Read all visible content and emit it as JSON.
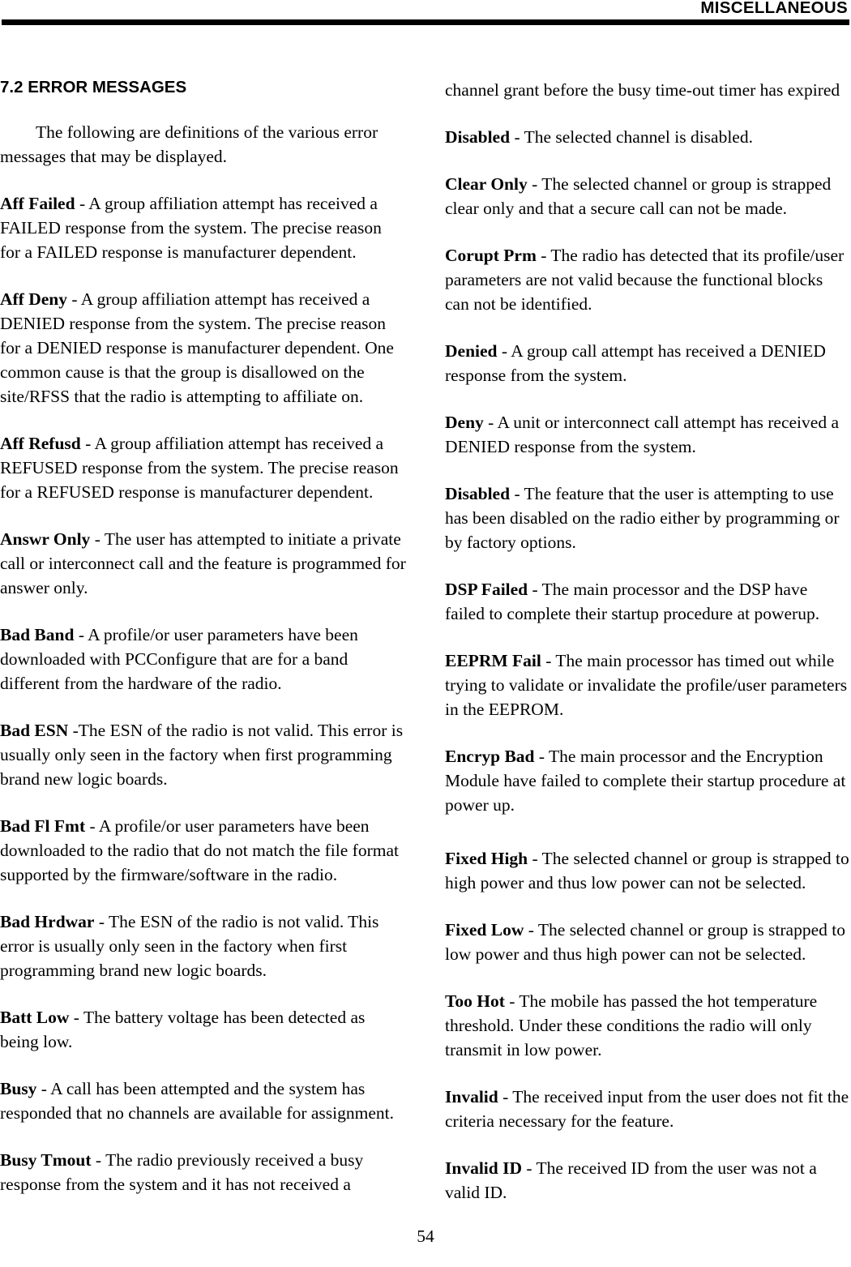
{
  "header": {
    "title": "MISCELLANEOUS"
  },
  "footer": {
    "page_number": "54"
  },
  "left_column": {
    "section_heading": "7.2 ERROR MESSAGES",
    "intro": "The following are definitions of the various error messages that may be displayed.",
    "entries": [
      {
        "term": "Aff Failed",
        "separator": " - ",
        "definition": "A group affiliation attempt has received a FAILED response from the system. The precise reason for a FAILED response is manufacturer dependent."
      },
      {
        "term": "Aff Deny",
        "separator": " - ",
        "definition": "A group affiliation attempt has received a DENIED response from the system. The precise reason for a DENIED response is manufacturer dependent. One common cause is that the group is disallowed on the site/RFSS that the radio is attempting to affiliate on."
      },
      {
        "term": "Aff Refusd",
        "separator": " - ",
        "definition": "A group affiliation attempt has received a REFUSED response from the system. The precise reason for a REFUSED response is manufacturer dependent."
      },
      {
        "term": "Answr Only",
        "separator": " - ",
        "definition": "The user has attempted to initiate a private call or interconnect call and the feature is programmed for answer only."
      },
      {
        "term": "Bad Band",
        "separator": " - ",
        "definition": "A profile/or user parameters have been downloaded with PCConfigure that are for a band different from the hardware of the radio."
      },
      {
        "term": "Bad ESN",
        "separator": " -",
        "definition": "The ESN of the radio is not valid. This error is usually only seen in the factory when first programming brand new logic boards."
      },
      {
        "term": "Bad Fl Fmt",
        "separator": " - ",
        "definition": "A profile/or user parameters have been downloaded to the radio that do not match the file format supported by the firmware/software in the radio."
      },
      {
        "term": "Bad Hrdwar",
        "separator": " - ",
        "definition": "The ESN of the radio is not valid. This error is usually only seen in the factory when first programming brand new logic boards."
      },
      {
        "term": "Batt Low",
        "separator": " - ",
        "definition": "The battery voltage has been detected as being low."
      },
      {
        "term": "Busy",
        "separator": " - ",
        "definition": "A call has been attempted and the system has responded that no channels are available for assignment."
      },
      {
        "term": "Busy Tmout",
        "separator": " - ",
        "definition": "The radio previously received a busy response from the system and it has not received a"
      }
    ]
  },
  "right_column": {
    "continuation": "channel grant before the busy time-out timer has expired",
    "entries": [
      {
        "term": "Disabled",
        "separator": " - ",
        "definition": "The selected channel is disabled."
      },
      {
        "term": "Clear Only",
        "separator": " - ",
        "definition": "The selected channel or group is strapped clear only and that a secure call can not be made."
      },
      {
        "term": "Corupt Prm",
        "separator": " - ",
        "definition": "The radio has detected that its profile/user parameters are not valid because the functional blocks can not be identified."
      },
      {
        "term": "Denied",
        "separator": " - ",
        "definition": "A group call attempt has received a DENIED response from the system."
      },
      {
        "term": "Deny",
        "separator": " - ",
        "definition": "A unit or interconnect call attempt has received a DENIED response from the system."
      },
      {
        "term": "Disabled",
        "separator": " - ",
        "definition": "The feature that the user is attempting to use has been disabled on the radio either by programming or by factory options."
      },
      {
        "term": "DSP Failed",
        "separator": " - ",
        "definition": "The main processor and the DSP have failed to complete their startup procedure at powerup."
      },
      {
        "term": "EEPRM Fail",
        "separator": " - ",
        "definition": "The main processor has timed out while trying to validate or invalidate the profile/user parameters in the EEPROM."
      },
      {
        "term": "Encryp Bad",
        "separator": " - ",
        "definition": "The main processor and the Encryption Module have failed to complete their startup procedure at power up."
      },
      {
        "term": "Fixed High",
        "separator": " - ",
        "definition": "The selected channel or group is strapped to high power and thus low power can not be selected."
      },
      {
        "term": "Fixed Low",
        "separator": " - ",
        "definition": "The selected channel or group is strapped to low power and thus high power can not be selected."
      },
      {
        "term": "Too Hot",
        "separator": " - ",
        "definition": "The mobile has passed the hot temperature threshold. Under these conditions the radio will only transmit in low power."
      },
      {
        "term": "Invalid",
        "separator": " - ",
        "definition": "The received input from the user does not fit the criteria necessary for the feature."
      },
      {
        "term": "Invalid ID",
        "separator": " - ",
        "definition": "The received ID from the user was not a valid ID."
      }
    ]
  }
}
